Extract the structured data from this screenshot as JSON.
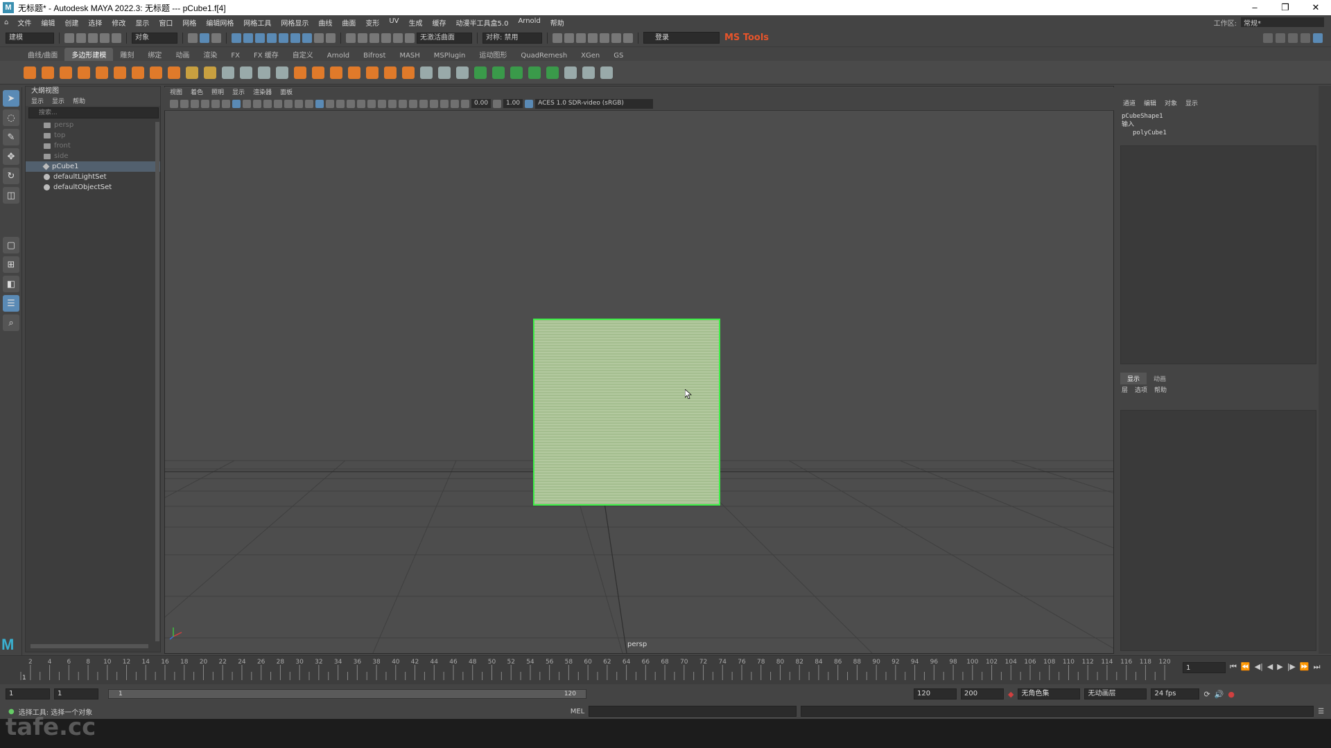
{
  "titlebar": {
    "title": "无标题* - Autodesk MAYA 2022.3: 无标题   ---   pCube1.f[4]",
    "min": "–",
    "restore": "❐",
    "close": "✕"
  },
  "menubar": {
    "items": [
      "文件",
      "编辑",
      "创建",
      "选择",
      "修改",
      "显示",
      "窗口",
      "网格",
      "编辑网格",
      "网格工具",
      "网格显示",
      "曲线",
      "曲面",
      "变形",
      "UV",
      "生成",
      "缓存",
      "动漫半工具盒5.0",
      "Arnold",
      "帮助"
    ],
    "workspace_label": "工作区:",
    "workspace_value": "常规*"
  },
  "statusline": {
    "mode": "建模",
    "object_label": "对象",
    "live_surface": "无激活曲面",
    "symmetry": "对称: 禁用",
    "login": "登录",
    "mstools": "MS Tools"
  },
  "shelftabs": [
    "曲线/曲面",
    "多边形建模",
    "雕刻",
    "绑定",
    "动画",
    "渲染",
    "FX",
    "FX 缓存",
    "自定义",
    "Arnold",
    "Bifrost",
    "MASH",
    "MSPlugin",
    "运动图形",
    "QuadRemesh",
    "XGen",
    "GS"
  ],
  "shelftab_active_index": 1,
  "outliner": {
    "title": "大纲视图",
    "menu": [
      "显示",
      "显示",
      "帮助"
    ],
    "search_placeholder": "搜索...",
    "rows": [
      {
        "label": "persp",
        "kind": "camera",
        "dim": true
      },
      {
        "label": "top",
        "kind": "camera",
        "dim": true
      },
      {
        "label": "front",
        "kind": "camera",
        "dim": true
      },
      {
        "label": "side",
        "kind": "camera",
        "dim": true
      },
      {
        "label": "pCube1",
        "kind": "mesh",
        "selected": true
      },
      {
        "label": "defaultLightSet",
        "kind": "set"
      },
      {
        "label": "defaultObjectSet",
        "kind": "set"
      }
    ]
  },
  "viewport": {
    "menu": [
      "视图",
      "着色",
      "照明",
      "显示",
      "渲染器",
      "面板"
    ],
    "exposure": "0.00",
    "gamma": "1.00",
    "colorspace": "ACES 1.0 SDR-video (sRGB)",
    "camera_label": "persp"
  },
  "channelbox": {
    "menu": [
      "通道",
      "编辑",
      "对象",
      "显示"
    ],
    "shape": "pCubeShape1",
    "inputs_label": "输入",
    "input_node": "polyCube1"
  },
  "layereditor": {
    "tabs": [
      "显示",
      "动画"
    ],
    "menu": [
      "层",
      "选项",
      "帮助"
    ]
  },
  "timeslider": {
    "ticks": [
      2,
      4,
      6,
      8,
      10,
      12,
      14,
      16,
      18,
      20,
      22,
      24,
      26,
      28,
      30,
      32,
      34,
      36,
      38,
      40,
      42,
      44,
      46,
      48,
      50,
      52,
      54,
      56,
      58,
      60,
      62,
      64,
      66,
      68,
      70,
      72,
      74,
      76,
      78,
      80,
      82,
      84,
      86,
      88,
      90,
      92,
      94,
      96,
      98,
      100,
      102,
      104,
      106,
      108,
      110,
      112,
      114,
      116,
      118,
      120
    ],
    "current_frame": "1",
    "start_marker": "1"
  },
  "rangebar": {
    "start": "1",
    "playback_start": "1",
    "slider_start": "1",
    "slider_end": "120",
    "playback_end": "120",
    "end": "200",
    "char_set": "无角色集",
    "anim_layer": "无动画层",
    "fps": "24 fps"
  },
  "cmdline": {
    "help_text": "选择工具: 选择一个对象",
    "lang": "MEL"
  },
  "watermark": "tafe.cc",
  "colors": {
    "selection_green": "#3cf046",
    "accent_blue": "#5a8ab5",
    "mstools_orange": "#e8542a"
  }
}
